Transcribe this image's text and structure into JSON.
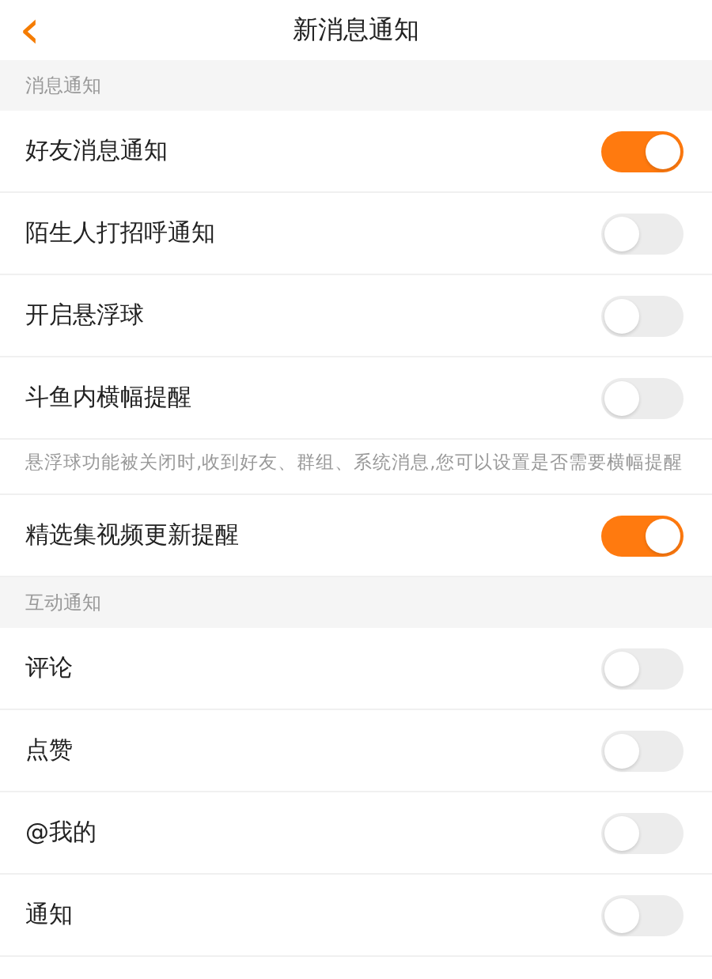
{
  "nav_bar": {
    "back_icon": "‹",
    "title": "新消息通知"
  },
  "sections": [
    {
      "title": "消息通知",
      "items": [
        {
          "kind": "toggle",
          "label": "好友消息通知",
          "on": true
        },
        {
          "kind": "toggle",
          "label": "陌生人打招呼通知",
          "on": false
        },
        {
          "kind": "toggle",
          "label": "开启悬浮球",
          "on": false
        },
        {
          "kind": "toggle",
          "label": "斗鱼内横幅提醒",
          "on": false
        },
        {
          "kind": "note",
          "text": "悬浮球功能被关闭时,收到好友、群组、系统消息,您可以设置是否需要横幅提醒"
        },
        {
          "kind": "toggle",
          "label": "精选集视频更新提醒",
          "on": true
        }
      ]
    },
    {
      "title": "互动通知",
      "items": [
        {
          "kind": "toggle",
          "label": "评论",
          "on": false
        },
        {
          "kind": "toggle",
          "label": "点赞",
          "on": false
        },
        {
          "kind": "toggle",
          "label": "@我的",
          "on": false
        },
        {
          "kind": "toggle",
          "label": "通知",
          "on": false
        }
      ]
    }
  ]
}
